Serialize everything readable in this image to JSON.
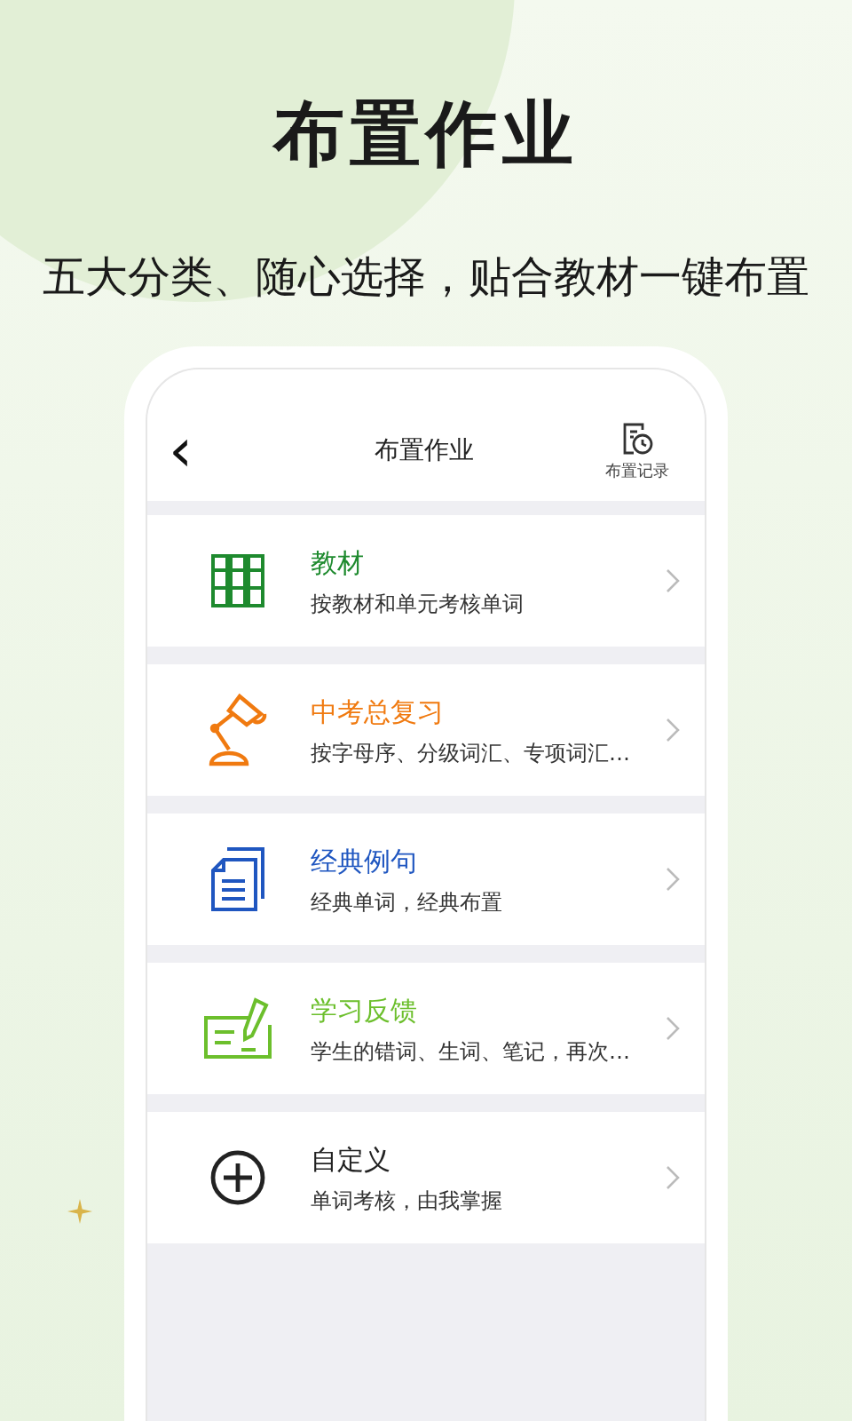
{
  "headline": "布置作业",
  "subtitle": "五大分类、随心选择，贴合教材一键布置",
  "app_bar": {
    "back": "‹",
    "title": "布置作业",
    "history_label": "布置记录"
  },
  "items": [
    {
      "kind": "books",
      "title": "教材",
      "description": "按教材和单元考核单词",
      "color": "#1e8a2e"
    },
    {
      "kind": "lamp",
      "title": "中考总复习",
      "description": "按字母序、分级词汇、专项词汇…",
      "color": "#f07a10"
    },
    {
      "kind": "document",
      "title": "经典例句",
      "description": "经典单词，经典布置",
      "color": "#1f56c0"
    },
    {
      "kind": "feedback",
      "title": "学习反馈",
      "description": "学生的错词、生词、笔记，再次…",
      "color": "#6cbf2c"
    },
    {
      "kind": "plus",
      "title": "自定义",
      "description": "单词考核，由我掌握",
      "color": "#222222"
    }
  ]
}
